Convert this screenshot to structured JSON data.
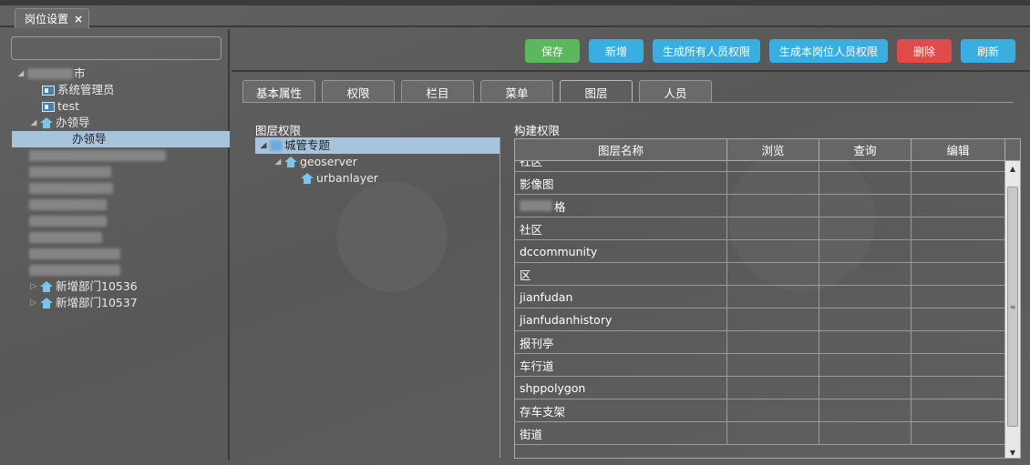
{
  "main_tab": {
    "label": "岗位设置",
    "close": "×"
  },
  "left_tree": {
    "root_suffix": "市",
    "items": [
      {
        "label": "系统管理员",
        "type": "card"
      },
      {
        "label": "test",
        "type": "card"
      },
      {
        "label": "办领导",
        "type": "house"
      },
      {
        "label": "办领导",
        "type": "child"
      },
      {
        "label": "新增部门10536",
        "type": "house"
      },
      {
        "label": "新增部门10537",
        "type": "house"
      }
    ],
    "blurred_count": 8
  },
  "toolbar": {
    "save": "保存",
    "add": "新增",
    "gen_all": "生成所有人员权限",
    "gen_post": "生成本岗位人员权限",
    "delete": "删除",
    "refresh": "刷新"
  },
  "sub_tabs": [
    "基本属性",
    "权限",
    "栏目",
    "菜单",
    "图层",
    "人员"
  ],
  "layer_perm": {
    "label": "图层权限",
    "root": "城管专题",
    "node1": "geoserver",
    "node2": "urbanlayer"
  },
  "build_perm": {
    "label": "构建权限",
    "columns": [
      "图层名称",
      "浏览",
      "查询",
      "编辑"
    ],
    "rows": [
      "社区",
      "影像图",
      "格",
      "社区",
      "dccommunity",
      "区",
      "jianfudan",
      "jianfudanhistory",
      "报刊亭",
      "车行道",
      "shppolygon",
      "存车支架",
      "街道"
    ]
  }
}
